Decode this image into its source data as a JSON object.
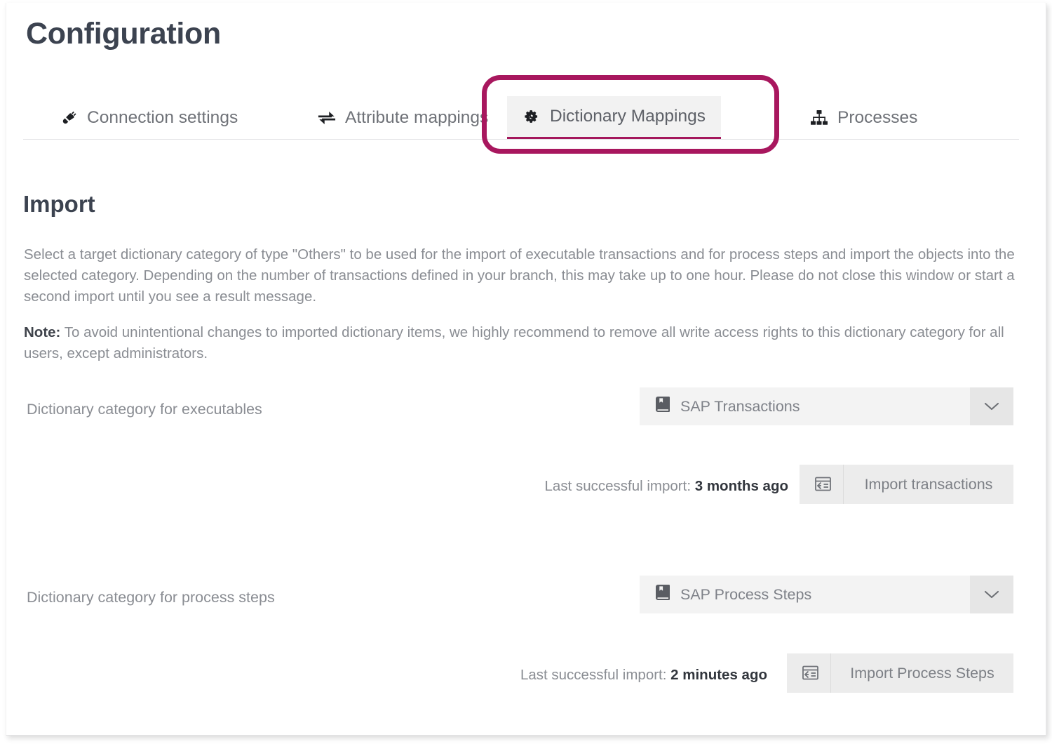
{
  "page": {
    "title": "Configuration"
  },
  "tabs": [
    {
      "label": "Connection settings",
      "icon": "plug-icon",
      "active": false
    },
    {
      "label": "Attribute mappings",
      "icon": "exchange-arrows-icon",
      "active": false
    },
    {
      "label": "Dictionary Mappings",
      "icon": "cogs-icon",
      "active": true
    },
    {
      "label": "Processes",
      "icon": "sitemap-icon",
      "active": false
    }
  ],
  "annotation": {
    "shape": "rounded-rectangle-highlight",
    "target": "Dictionary Mappings",
    "color": "#a8175e"
  },
  "import_section": {
    "heading": "Import",
    "description": "Select a target dictionary category of type \"Others\" to be used for the import of executable transactions and for process steps and import the objects into the selected category. Depending on the number of transactions defined in your branch, this may take up to one hour. Please do not close this window or start a second import until you see a result message.",
    "note_label": "Note:",
    "note_text": " To avoid unintentional changes to imported dictionary items, we highly recommend to remove all write access rights to this dictionary category for all users, except administrators.",
    "rows": [
      {
        "field_label": "Dictionary category for executables",
        "dropdown_value": "SAP Transactions",
        "dropdown_icon": "book-icon",
        "caret_icon": "chevron-down-icon",
        "status_prefix": "Last successful import: ",
        "status_value": "3 months ago",
        "button_label": "Import transactions",
        "button_icon": "import-window-icon"
      },
      {
        "field_label": "Dictionary category for process steps",
        "dropdown_value": "SAP Process Steps",
        "dropdown_icon": "book-icon",
        "caret_icon": "chevron-down-icon",
        "status_prefix": "Last successful import: ",
        "status_value": "2 minutes ago",
        "button_label": "Import Process Steps",
        "button_icon": "import-window-icon"
      }
    ]
  },
  "colors": {
    "accent": "#a4175c",
    "annotation": "#a8175e",
    "title_text": "#3c4350",
    "body_text": "#8a8d93",
    "control_bg": "#f3f3f3"
  }
}
